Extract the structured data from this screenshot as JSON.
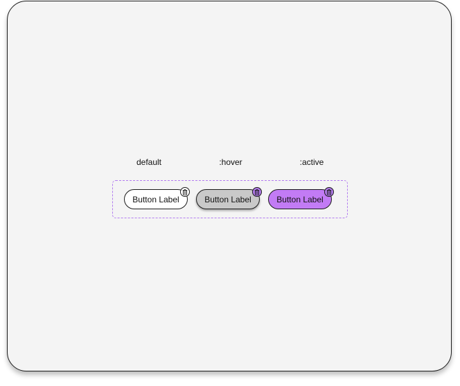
{
  "states": {
    "default": ":hover",
    "default_label": "default",
    "hover_label": ":hover",
    "active_label": ":active"
  },
  "buttons": {
    "default_label": "Button Label",
    "hover_label": "Button Label",
    "active_label": "Button Label"
  },
  "icons": {
    "badge": "trash-icon"
  },
  "colors": {
    "frame_bg": "#f4f4f4",
    "default_fill": "#ffffff",
    "hover_fill": "#c9c9c9",
    "active_fill": "#c27bf5",
    "badge_accent": "#b07ae8",
    "dashed_outline": "#b27cf0"
  }
}
